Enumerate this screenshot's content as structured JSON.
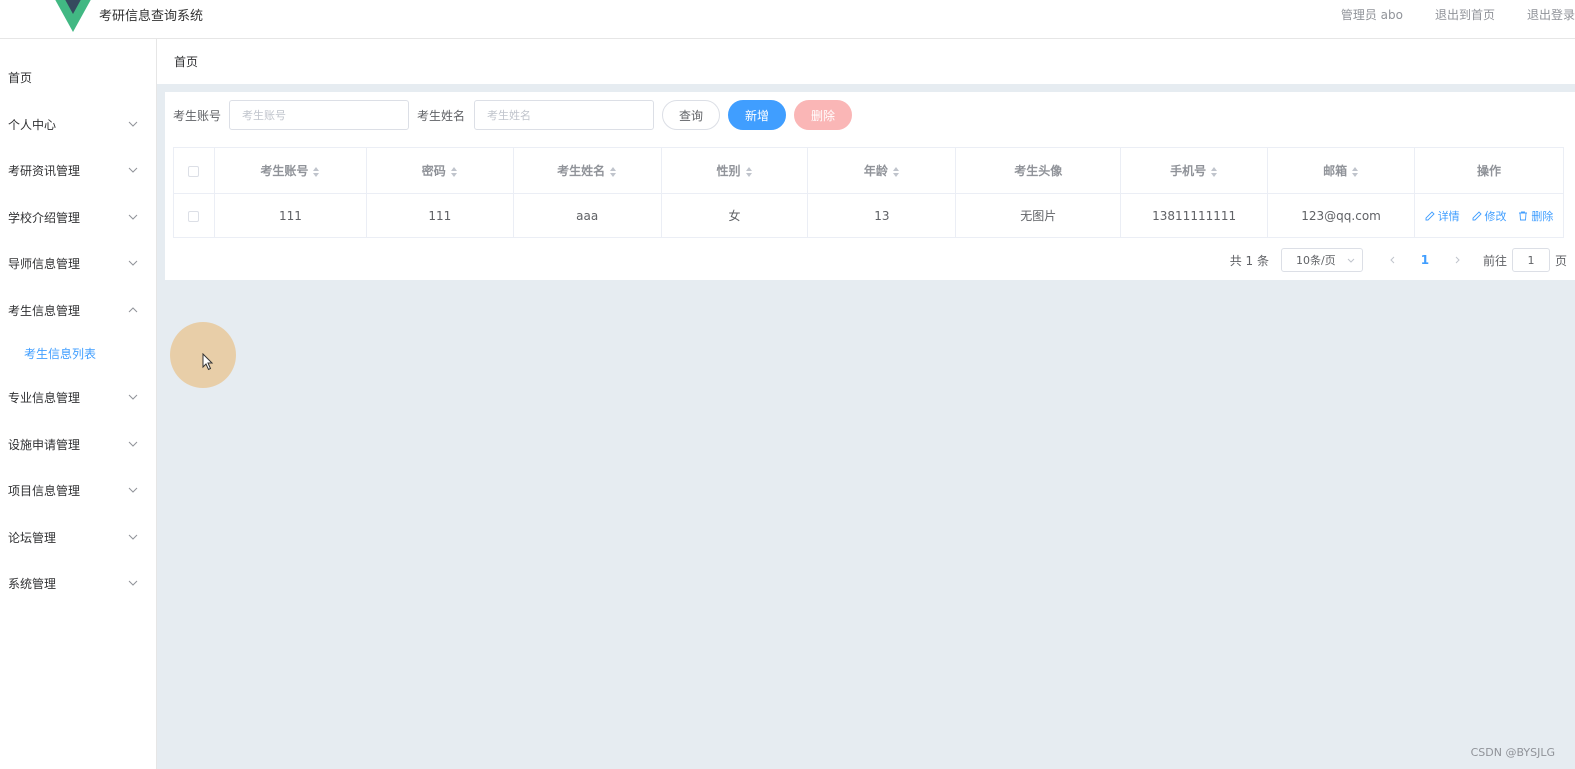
{
  "header": {
    "app_title": "考研信息查询系统",
    "user_label": "管理员 abo",
    "back_home": "退出到首页",
    "logout": "退出登录"
  },
  "sidebar": {
    "items": [
      {
        "label": "首页",
        "icon": "none"
      },
      {
        "label": "个人中心",
        "icon": "chevron-down-icon"
      },
      {
        "label": "考研资讯管理",
        "icon": "chevron-down-icon"
      },
      {
        "label": "学校介绍管理",
        "icon": "chevron-down-icon"
      },
      {
        "label": "导师信息管理",
        "icon": "chevron-down-icon"
      },
      {
        "label": "考生信息管理",
        "icon": "chevron-up-icon",
        "expanded": true
      },
      {
        "label": "专业信息管理",
        "icon": "chevron-down-icon"
      },
      {
        "label": "设施申请管理",
        "icon": "chevron-down-icon"
      },
      {
        "label": "项目信息管理",
        "icon": "chevron-down-icon"
      },
      {
        "label": "论坛管理",
        "icon": "chevron-down-icon"
      },
      {
        "label": "系统管理",
        "icon": "chevron-down-icon"
      }
    ],
    "submenu_active": "考生信息列表"
  },
  "breadcrumb": "首页",
  "search": {
    "account_label": "考生账号",
    "account_placeholder": "考生账号",
    "name_label": "考生姓名",
    "name_placeholder": "考生姓名",
    "query_btn": "查询",
    "add_btn": "新增",
    "delete_btn": "删除"
  },
  "table": {
    "columns": [
      "考生账号",
      "密码",
      "考生姓名",
      "性别",
      "年龄",
      "考生头像",
      "手机号",
      "邮箱",
      "操作"
    ],
    "rows": [
      {
        "account": "111",
        "password": "111",
        "name": "aaa",
        "gender": "女",
        "age": "13",
        "avatar": "无图片",
        "phone": "13811111111",
        "email": "123@qq.com"
      }
    ],
    "actions": {
      "detail": "详情",
      "edit": "修改",
      "delete": "删除"
    }
  },
  "pagination": {
    "total": "共 1 条",
    "page_size": "10条/页",
    "current_page": "1",
    "goto_prefix": "前往",
    "goto_value": "1",
    "goto_suffix": "页"
  },
  "watermark": "CSDN @BYSJLG",
  "colors": {
    "primary": "#409eff",
    "danger_disabled": "#fab6b6",
    "main_bg": "#e6ecf1"
  }
}
